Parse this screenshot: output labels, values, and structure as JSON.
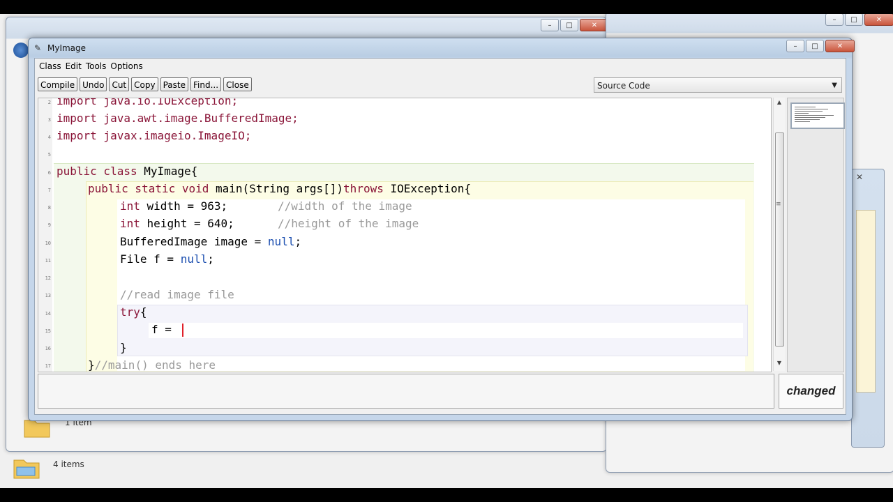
{
  "background": {
    "explorer_status_text": "1 item",
    "taskbar_item_count": "4 items"
  },
  "editor": {
    "window_title": "MyImage",
    "menu": [
      "Class",
      "Edit",
      "Tools",
      "Options"
    ],
    "toolbar": {
      "compile": "Compile",
      "undo": "Undo",
      "cut": "Cut",
      "copy": "Copy",
      "paste": "Paste",
      "find": "Find...",
      "close": "Close"
    },
    "view_selector": "Source Code",
    "status_label": "changed",
    "line_numbers": [
      "2",
      "3",
      "4",
      "5",
      "6",
      "7",
      "8",
      "9",
      "10",
      "11",
      "12",
      "13",
      "14",
      "15",
      "16",
      "17"
    ],
    "code": {
      "l2": "import java.io.IOException;",
      "l3": "import java.awt.image.BufferedImage;",
      "l4": "import javax.imageio.ImageIO;",
      "l6a": "public class",
      "l6b": " MyImage{",
      "l7a": "public static void",
      "l7b": " main(String args[])",
      "l7c": "throws",
      "l7d": " IOException{",
      "l8a": "int",
      "l8b": " width = 963;",
      "l8c": "//width of the image",
      "l9a": "int",
      "l9b": " height = 640;",
      "l9c": "//height of the image",
      "l10a": "BufferedImage image = ",
      "l10b": "null",
      "l10c": ";",
      "l11a": "File f = ",
      "l11b": "null",
      "l11c": ";",
      "l13": "//read image file",
      "l14a": "try",
      "l14b": "{",
      "l15": "f = ",
      "l16": "}",
      "l17a": "}",
      "l17b": "//main() ends here"
    }
  },
  "colors": {
    "keyword": "#8a1538",
    "comment": "#9a9a9a",
    "literal": "#1c4fb0",
    "cursor": "#e0202a"
  }
}
